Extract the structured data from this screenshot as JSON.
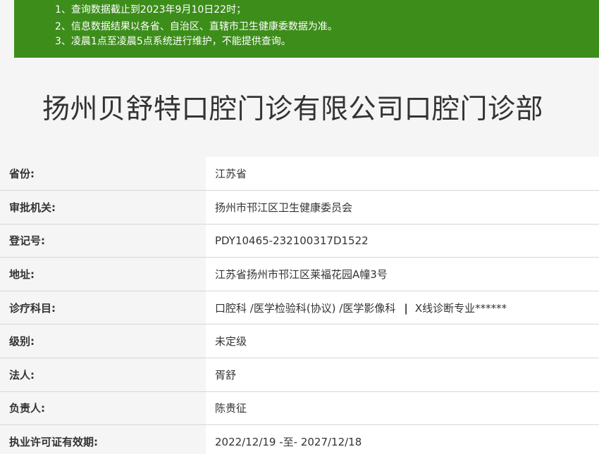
{
  "notice": {
    "lines": [
      "1、查询数据截止到2023年9月10日22时；",
      "2、信息数据结果以各省、自治区、直辖市卫生健康委数据为准。",
      "3、凌晨1点至凌晨5点系统进行维护，不能提供查询。"
    ]
  },
  "title": "扬州贝舒特口腔门诊有限公司口腔门诊部",
  "rows": [
    {
      "label": "省份:",
      "value": "江苏省"
    },
    {
      "label": "审批机关:",
      "value": "扬州市邗江区卫生健康委员会"
    },
    {
      "label": "登记号:",
      "value": "PDY10465-232100317D1522"
    },
    {
      "label": "地址:",
      "value": "江苏省扬州市邗江区莱福花园A幢3号"
    },
    {
      "label": "诊疗科目:",
      "value_main": "口腔科 /医学检验科(协议) /医学影像科",
      "value_sep": "|",
      "value_extra": "X线诊断专业******"
    },
    {
      "label": "级别:",
      "value": "未定级"
    },
    {
      "label": "法人:",
      "value": "胥舒"
    },
    {
      "label": "负责人:",
      "value": "陈贵征"
    },
    {
      "label": "执业许可证有效期:",
      "value": "2022/12/19 -至- 2027/12/18"
    }
  ],
  "colors": {
    "notice_bg": "#3d8d1b",
    "notice_text": "#ffffff",
    "text": "#333333",
    "row_border": "#d6d6d6"
  }
}
